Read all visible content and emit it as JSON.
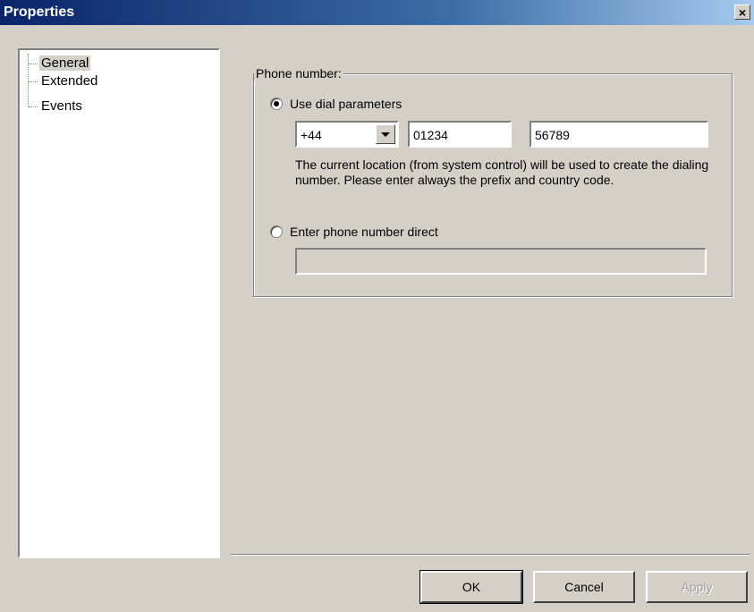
{
  "window": {
    "title": "Properties",
    "close_glyph": "×"
  },
  "tree": {
    "items": [
      {
        "label": "General",
        "selected": true
      },
      {
        "label": "Extended",
        "selected": false
      },
      {
        "label": "Events",
        "selected": false
      }
    ]
  },
  "phone": {
    "group_label": "Phone number:",
    "use_dial_label": "Use dial parameters",
    "use_dial_checked": true,
    "country_code": "+44",
    "area_code": "01234",
    "number": "56789",
    "info": "The current location (from system control) will be used to create the dialing number. Please enter always the prefix and country code.",
    "direct_label": "Enter phone number direct",
    "direct_checked": false,
    "direct_value": ""
  },
  "buttons": {
    "ok": "OK",
    "cancel": "Cancel",
    "apply": "Apply"
  }
}
